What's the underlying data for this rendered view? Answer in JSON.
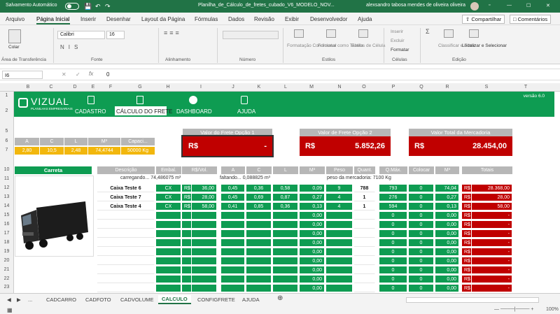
{
  "titlebar": {
    "autosave": "Salvamento Automático",
    "filename": "Planilha_de_Cálculo_de_fretes_cubado_V6_MODELO_NOV...",
    "user": "alexsandro tabosa mendes de oliveira oliveira"
  },
  "menu": {
    "tabs": [
      "Arquivo",
      "Página Inicial",
      "Inserir",
      "Desenhar",
      "Layout da Página",
      "Fórmulas",
      "Dados",
      "Revisão",
      "Exibir",
      "Desenvolvedor",
      "Ajuda"
    ],
    "share": "Compartilhar",
    "comments": "Comentários"
  },
  "ribbon": {
    "paste": "Colar",
    "clipboard": "Área de Transferência",
    "font_name": "Calibri",
    "font_size": "16",
    "font_group": "Fonte",
    "align_group": "Alinhamento",
    "number_group": "Número",
    "cond_fmt": "Formatação Condicional",
    "fmt_table": "Formatar como Tabela",
    "cell_styles": "Estilos de Célula",
    "styles_group": "Estilos",
    "insert": "Inserir",
    "delete": "Excluir",
    "format": "Formatar",
    "cells_group": "Células",
    "sort_filter": "Classificar e Filtrar",
    "find_select": "Localizar e Selecionar",
    "edit_group": "Edição"
  },
  "formula": {
    "cell_ref": "I6",
    "content": "0"
  },
  "columns": [
    "A",
    "B",
    "C",
    "D",
    "E",
    "F",
    "G",
    "H",
    "I",
    "J",
    "K",
    "L",
    "M",
    "N",
    "O",
    "P",
    "Q",
    "R",
    "S",
    "T"
  ],
  "rows": [
    "1",
    "2",
    "5",
    "6",
    "7",
    "10",
    "11",
    "12",
    "13",
    "14",
    "15",
    "16",
    "17",
    "18",
    "19",
    "20",
    "21",
    "22",
    "23"
  ],
  "header": {
    "brand": "VIZUAL",
    "brand_sub": "PLANILHAS EMPRESARIAIS",
    "version": "versão 6.0",
    "nav": [
      "CADASTRO",
      "CÁLCULO DO FRETE",
      "DASHBOARD",
      "AJUDA"
    ]
  },
  "kpis": [
    {
      "label": "Valor do Frete Opção 1",
      "currency": "R$",
      "value": "-"
    },
    {
      "label": "Valor de Frete Opção 2",
      "currency": "R$",
      "value": "5.852,26"
    },
    {
      "label": "Valor Total da Mercadoria",
      "currency": "R$",
      "value": "28.454,00"
    }
  ],
  "dims": {
    "headers": [
      "A",
      "C",
      "L",
      "M³",
      "Capaci..."
    ],
    "values": [
      "2,80",
      "10,5",
      "2,48",
      "74,4744",
      "50000 Kg"
    ]
  },
  "vehicle": {
    "label": "Carreta",
    "image_icon": "truck-image"
  },
  "table": {
    "headers": [
      "Descrição",
      "Embal.",
      "R$/Vol.",
      "A",
      "C",
      "L",
      "M³",
      "Peso",
      "Quant.",
      "Q.Máx.",
      "Colocar",
      "M³",
      "Totais"
    ],
    "info_left": "carregando... 74,486075 m³",
    "info_mid": "faltando... 0,088825 m³",
    "info_right": "peso da mercadoria: 7100 Kg",
    "rows": [
      {
        "desc": "Caixa Teste 6",
        "emb": "CX",
        "cur": "R$",
        "price": "36,00",
        "a": "0,45",
        "c": "0,36",
        "l": "0,58",
        "m3": "0,09",
        "peso": "9",
        "quant": "788",
        "qmax": "793",
        "colocar": "0",
        "m3b": "74,04",
        "tcur": "R$",
        "total": "28.368,00"
      },
      {
        "desc": "Caixa Teste 7",
        "emb": "CX",
        "cur": "R$",
        "price": "28,00",
        "a": "0,45",
        "c": "0,69",
        "l": "0,87",
        "m3": "0,27",
        "peso": "4",
        "quant": "1",
        "qmax": "276",
        "colocar": "0",
        "m3b": "0,27",
        "tcur": "R$",
        "total": "28,00"
      },
      {
        "desc": "Caixa Teste 4",
        "emb": "CX",
        "cur": "R$",
        "price": "58,00",
        "a": "0,41",
        "c": "0,85",
        "l": "0,36",
        "m3": "0,13",
        "peso": "4",
        "quant": "1",
        "qmax": "594",
        "colocar": "0",
        "m3b": "0,13",
        "tcur": "R$",
        "total": "58,00"
      },
      {
        "m3": "0,00",
        "qmax": "0",
        "colocar": "0",
        "m3b": "0,00",
        "tcur": "R$",
        "total": "-"
      },
      {
        "m3": "0,00",
        "qmax": "0",
        "colocar": "0",
        "m3b": "0,00",
        "tcur": "R$",
        "total": "-"
      },
      {
        "m3": "0,00",
        "qmax": "0",
        "colocar": "0",
        "m3b": "0,00",
        "tcur": "R$",
        "total": "-"
      },
      {
        "m3": "0,00",
        "qmax": "0",
        "colocar": "0",
        "m3b": "0,00",
        "tcur": "R$",
        "total": "-"
      },
      {
        "m3": "0,00",
        "qmax": "0",
        "colocar": "0",
        "m3b": "0,00",
        "tcur": "R$",
        "total": "-"
      },
      {
        "m3": "0,00",
        "qmax": "0",
        "colocar": "0",
        "m3b": "0,00",
        "tcur": "R$",
        "total": "-"
      },
      {
        "m3": "0,00",
        "qmax": "0",
        "colocar": "0",
        "m3b": "0,00",
        "tcur": "R$",
        "total": "-"
      },
      {
        "m3": "0,00",
        "qmax": "0",
        "colocar": "0",
        "m3b": "0,00",
        "tcur": "R$",
        "total": "-"
      },
      {
        "m3": "0,00",
        "qmax": "0",
        "colocar": "0",
        "m3b": "0,00",
        "tcur": "R$",
        "total": "-"
      }
    ]
  },
  "sheet_tabs": [
    "CADCARRO",
    "CADFOTO",
    "CADVOLUME",
    "CALCULO",
    "CONFIGFRETE",
    "AJUDA"
  ],
  "active_sheet": "CALCULO",
  "zoom": "100%",
  "colors": {
    "excel_green": "#217346",
    "brand_green": "#0e9c52",
    "red": "#c00000",
    "yellow": "#f2b70d",
    "gray": "#b7b7b7"
  }
}
